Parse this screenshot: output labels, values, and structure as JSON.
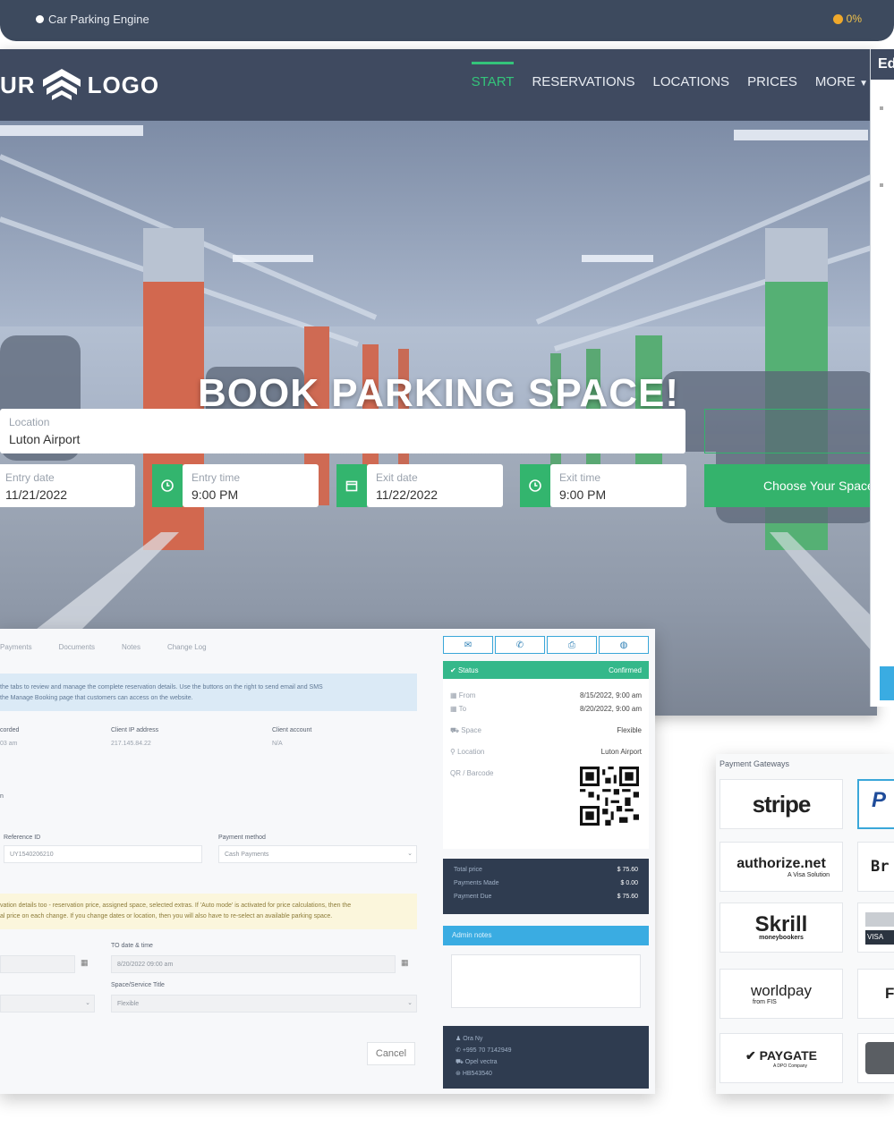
{
  "app": {
    "title": "Car Parking Engine",
    "progress": "0%"
  },
  "site": {
    "logo_left": "UR",
    "logo_right": "LOGO",
    "nav": [
      "START",
      "RESERVATIONS",
      "LOCATIONS",
      "PRICES",
      "MORE"
    ],
    "heading": "BOOK PARKING SPACE!",
    "form": {
      "location_label": "Location",
      "location_value": "Luton Airport",
      "entry_date_label": "Entry date",
      "entry_date_value": "11/21/2022",
      "entry_time_label": "Entry time",
      "entry_time_value": "9:00 PM",
      "exit_date_label": "Exit date",
      "exit_date_value": "11/22/2022",
      "exit_time_label": "Exit time",
      "exit_time_value": "9:00 PM",
      "submit": "Choose Your Space"
    }
  },
  "edge_panel": {
    "title": "Ed"
  },
  "booking": {
    "tabs": [
      "Payments",
      "Documents",
      "Notes",
      "Change Log"
    ],
    "info": [
      "the tabs to review and manage the complete reservation details. Use the buttons on the right to send email and SMS",
      "the Manage Booking page that customers can access on the website."
    ],
    "recorded_label": "corded",
    "recorded_value": "03 am",
    "ip_label": "Client IP address",
    "ip_value": "217.145.84.22",
    "account_label": "Client account",
    "account_value": "N/A",
    "section": "n",
    "reference_label": "Reference ID",
    "reference_value": "UY1540206210",
    "payment_label": "Payment method",
    "payment_value": "Cash Payments",
    "warning": [
      "vation details too - reservation price, assigned space, selected extras. If 'Auto mode' is activated for price calculations, then the",
      "al price on each change. If you change dates or location, then you will also have to re-select an available parking space."
    ],
    "to_label": "TO date & time",
    "to_value": "8/20/2022 09:00 am",
    "space_label": "Space/Service Title",
    "space_value": "Flexible",
    "cancel": "Cancel",
    "status_label": "Status",
    "status_value": "Confirmed",
    "from_label": "From",
    "from_value": "8/15/2022, 9:00 am",
    "to2_label": "To",
    "to2_value": "8/20/2022, 9:00 am",
    "space2_label": "Space",
    "space2_value": "Flexible",
    "location_label": "Location",
    "location_value": "Luton Airport",
    "qr_label": "QR / Barcode",
    "total_label": "Total price",
    "total_value": "$ 75.60",
    "made_label": "Payments Made",
    "made_value": "$ 0.00",
    "due_label": "Payment Due",
    "due_value": "$ 75.60",
    "admin_notes": "Admin notes",
    "client": [
      "Ora Ny",
      "+995 70 7142949",
      "Opel vectra",
      "HB543540"
    ]
  },
  "payments": {
    "header": "Payment Gateways",
    "stripe": "stripe",
    "authorize": "authorize.net",
    "authorize_sub": "A Visa Solution",
    "skrill": "Skrill",
    "skrill_sub": "moneybookers",
    "worldpay": "worldpay",
    "worldpay_sub": "from FIS",
    "paygate": "PAYGATE",
    "paygate_sub": "A DPO Company",
    "br": "Br",
    "visa": "VISA"
  }
}
